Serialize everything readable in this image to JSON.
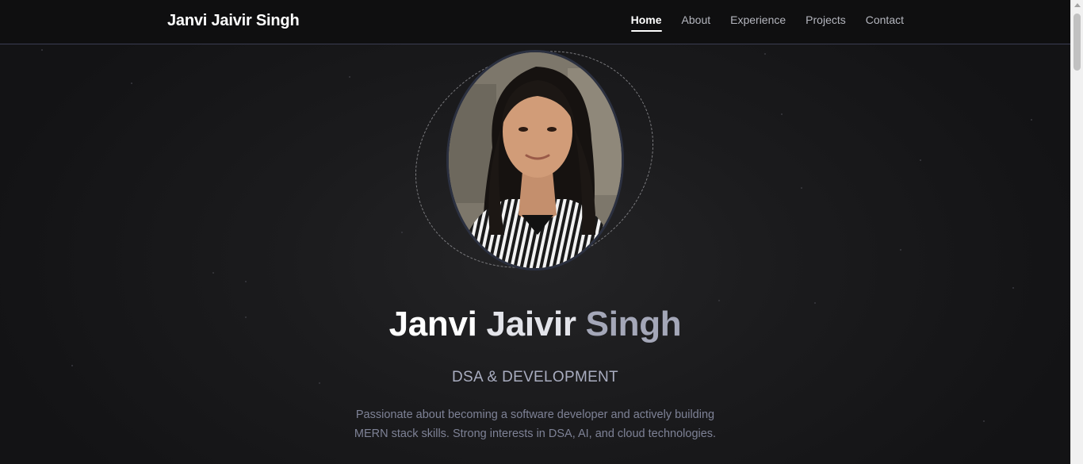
{
  "navbar": {
    "brand": "Janvi Jaivir Singh",
    "links": [
      {
        "label": "Home",
        "active": true
      },
      {
        "label": "About",
        "active": false
      },
      {
        "label": "Experience",
        "active": false
      },
      {
        "label": "Projects",
        "active": false
      },
      {
        "label": "Contact",
        "active": false
      }
    ]
  },
  "hero": {
    "title_words": [
      "Janvi",
      "Jaivir",
      "Singh"
    ],
    "subtitle": "DSA & DEVELOPMENT",
    "description_line1": "Passionate about becoming a software developer and actively building",
    "description_line2": "MERN stack skills. Strong interests in DSA, AI, and cloud technologies."
  },
  "colors": {
    "background": "#151517",
    "navbar_bg": "#0f0f10",
    "navbar_border": "#3b3d52",
    "title_fade_end": "#a4a7b8",
    "subtitle": "#a9adc0",
    "description": "#7e8296"
  }
}
